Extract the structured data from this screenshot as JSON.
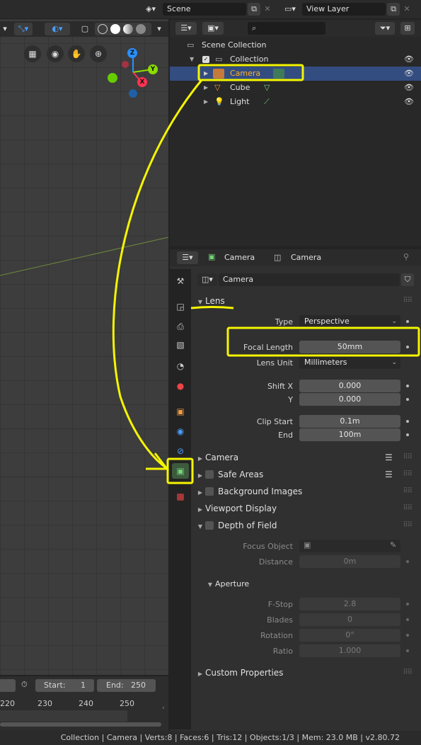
{
  "topbar": {
    "scene_label": "Scene",
    "view_layer_label": "View Layer"
  },
  "outliner": {
    "scene_collection": "Scene Collection",
    "collection": "Collection",
    "items": [
      {
        "label": "Camera"
      },
      {
        "label": "Cube"
      },
      {
        "label": "Light"
      }
    ]
  },
  "viewport": {
    "axes": {
      "z": "Z",
      "y": "Y",
      "x": "X"
    }
  },
  "properties": {
    "header_object": "Camera",
    "header_data": "Camera",
    "datablock_name": "Camera",
    "lens": {
      "title": "Lens",
      "type_label": "Type",
      "type_value": "Perspective",
      "focal_length_label": "Focal Length",
      "focal_length_value": "50mm",
      "lens_unit_label": "Lens Unit",
      "lens_unit_value": "Millimeters",
      "shift_x_label": "Shift X",
      "shift_x_value": "0.000",
      "shift_y_label": "Y",
      "shift_y_value": "0.000",
      "clip_start_label": "Clip Start",
      "clip_start_value": "0.1m",
      "clip_end_label": "End",
      "clip_end_value": "100m"
    },
    "panels": {
      "camera": "Camera",
      "safe_areas": "Safe Areas",
      "background_images": "Background Images",
      "viewport_display": "Viewport Display",
      "depth_of_field": "Depth of Field",
      "aperture": "Aperture",
      "custom_properties": "Custom Properties"
    },
    "dof": {
      "focus_object_label": "Focus Object",
      "distance_label": "Distance",
      "distance_value": "0m",
      "fstop_label": "F-Stop",
      "fstop_value": "2.8",
      "blades_label": "Blades",
      "blades_value": "0",
      "rotation_label": "Rotation",
      "rotation_value": "0°",
      "ratio_label": "Ratio",
      "ratio_value": "1.000"
    }
  },
  "timeline": {
    "start_label": "Start:",
    "start_value": "1",
    "end_label": "End:",
    "end_value": "250",
    "ticks": [
      "220",
      "230",
      "240",
      "250"
    ]
  },
  "statusbar": {
    "text": "Collection | Camera | Verts:8 | Faces:6 | Tris:12 | Objects:1/3 | Mem: 23.0 MB | v2.80.72"
  },
  "colors": {
    "highlight": "#f5f500",
    "selection": "#334d80",
    "axis_x": "#ff3352",
    "axis_y": "#8bdc00",
    "axis_z": "#2890ff"
  }
}
